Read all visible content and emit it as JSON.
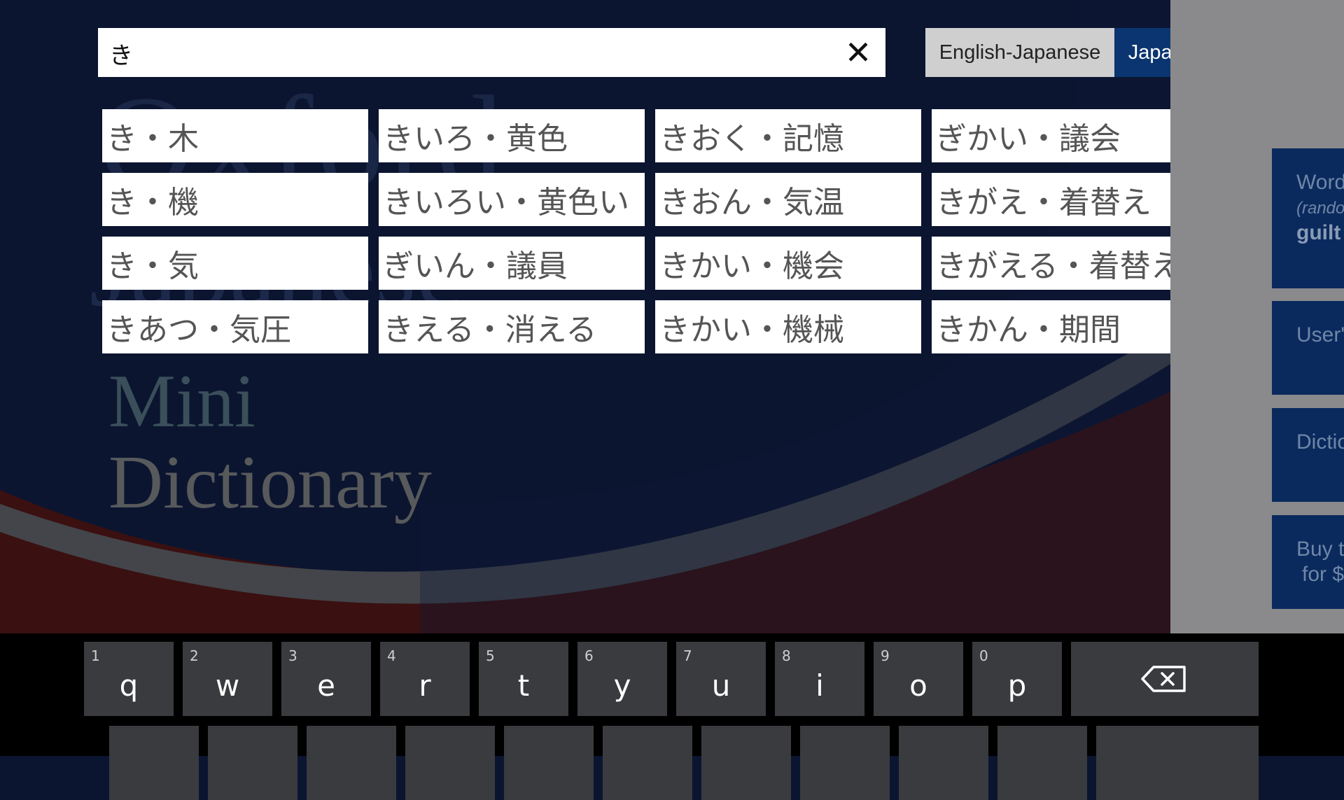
{
  "cover": {
    "title_line1": "Oxford",
    "title_line2": "Japanese",
    "title_line3": "Mini",
    "title_line4": "Dictionary"
  },
  "search": {
    "value": "き",
    "clear_icon": "close-icon"
  },
  "language_toggle": {
    "english_japanese": "English-Japanese",
    "japanese_english": "Japanese-English",
    "active": "japanese_english"
  },
  "suggestions": [
    "き・木",
    "きいろ・黄色",
    "きおく・記憶",
    "ぎかい・議会",
    "き・機",
    "きいろい・黄色い",
    "きおん・気温",
    "きがえ・着替え",
    "き・気",
    "ぎいん・議員",
    "きかい・機会",
    "きがえる・着替える",
    "きあつ・気圧",
    "きえる・消える",
    "きかい・機械",
    "きかん・期間"
  ],
  "side_tiles": {
    "word_title": "Word",
    "word_sub": "(rando",
    "word_value": "guilt",
    "user": "User'",
    "dictionary": "Dictio",
    "buy_line1": "Buy th",
    "buy_line2": "for $"
  },
  "keyboard": {
    "row1": [
      {
        "num": "1",
        "ch": "q"
      },
      {
        "num": "2",
        "ch": "w"
      },
      {
        "num": "3",
        "ch": "e"
      },
      {
        "num": "4",
        "ch": "r"
      },
      {
        "num": "5",
        "ch": "t"
      },
      {
        "num": "6",
        "ch": "y"
      },
      {
        "num": "7",
        "ch": "u"
      },
      {
        "num": "8",
        "ch": "i"
      },
      {
        "num": "9",
        "ch": "o"
      },
      {
        "num": "0",
        "ch": "p"
      }
    ],
    "backspace_icon": "backspace-icon"
  },
  "colors": {
    "background_navy": "#0b1530",
    "accent_blue": "#0a3570",
    "red_band": "#5a1010",
    "keyboard_key": "#3a3b3f"
  }
}
